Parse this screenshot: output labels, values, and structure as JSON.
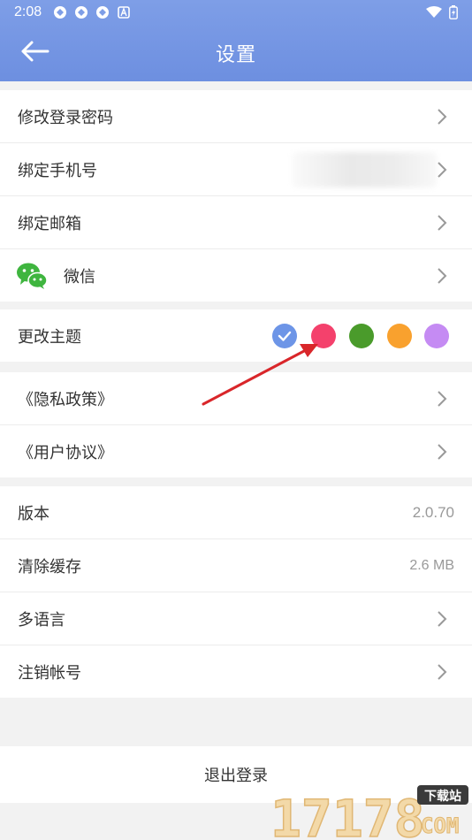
{
  "status_bar": {
    "time": "2:08"
  },
  "header": {
    "title": "设置"
  },
  "account_group": [
    {
      "label": "修改登录密码"
    },
    {
      "label": "绑定手机号"
    },
    {
      "label": "绑定邮箱"
    },
    {
      "label": "微信"
    }
  ],
  "theme": {
    "label": "更改主题",
    "colors": [
      "#6d95e7",
      "#f4416c",
      "#4a9b2b",
      "#f9a12e",
      "#c58bf3"
    ],
    "selected": 0
  },
  "policy_group": [
    {
      "label": "《隐私政策》"
    },
    {
      "label": "《用户协议》"
    }
  ],
  "info_group": {
    "version": {
      "label": "版本",
      "value": "2.0.70"
    },
    "cache": {
      "label": "清除缓存",
      "value": "2.6 MB"
    },
    "language": {
      "label": "多语言"
    },
    "delete_account": {
      "label": "注销帐号"
    }
  },
  "logout_label": "退出登录",
  "watermark": {
    "number": "17178",
    "badge": "下载站",
    "domain": "COM"
  }
}
